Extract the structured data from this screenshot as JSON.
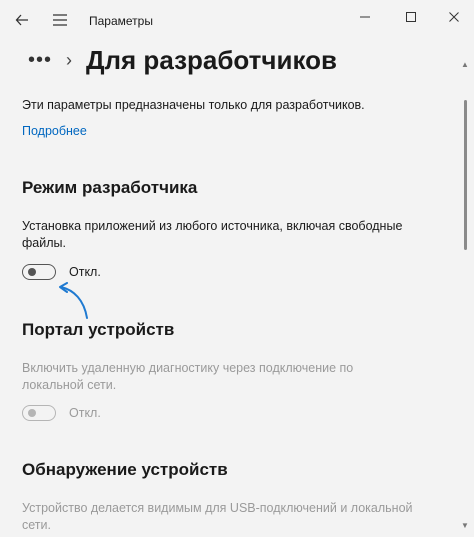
{
  "window": {
    "title": "Параметры"
  },
  "header": {
    "more_label": "•••",
    "page_title": "Для разработчиков"
  },
  "intro": {
    "description": "Эти параметры предназначены только для разработчиков.",
    "learn_more": "Подробнее"
  },
  "sections": {
    "dev_mode": {
      "title": "Режим разработчика",
      "description_line1": "Установка приложений из любого источника, включая свободные",
      "description_line2": "файлы.",
      "toggle_state": "Откл."
    },
    "device_portal": {
      "title": "Портал устройств",
      "description_line1": "Включить удаленную диагностику через подключение по",
      "description_line2": "локальной сети.",
      "toggle_state": "Откл."
    },
    "device_discovery": {
      "title": "Обнаружение устройств",
      "description_line1": "Устройство делается видимым для USB-подключений и локальной",
      "description_line2": "сети."
    }
  },
  "colors": {
    "background": "#f3f3f3",
    "link": "#0067c0",
    "arrow": "#1f7ad1",
    "disabled_text": "#9a9a9a"
  },
  "icons": {
    "back": "back-arrow-icon",
    "menu": "hamburger-menu-icon",
    "minimize": "minimize-icon",
    "maximize": "maximize-icon",
    "close": "close-icon"
  }
}
